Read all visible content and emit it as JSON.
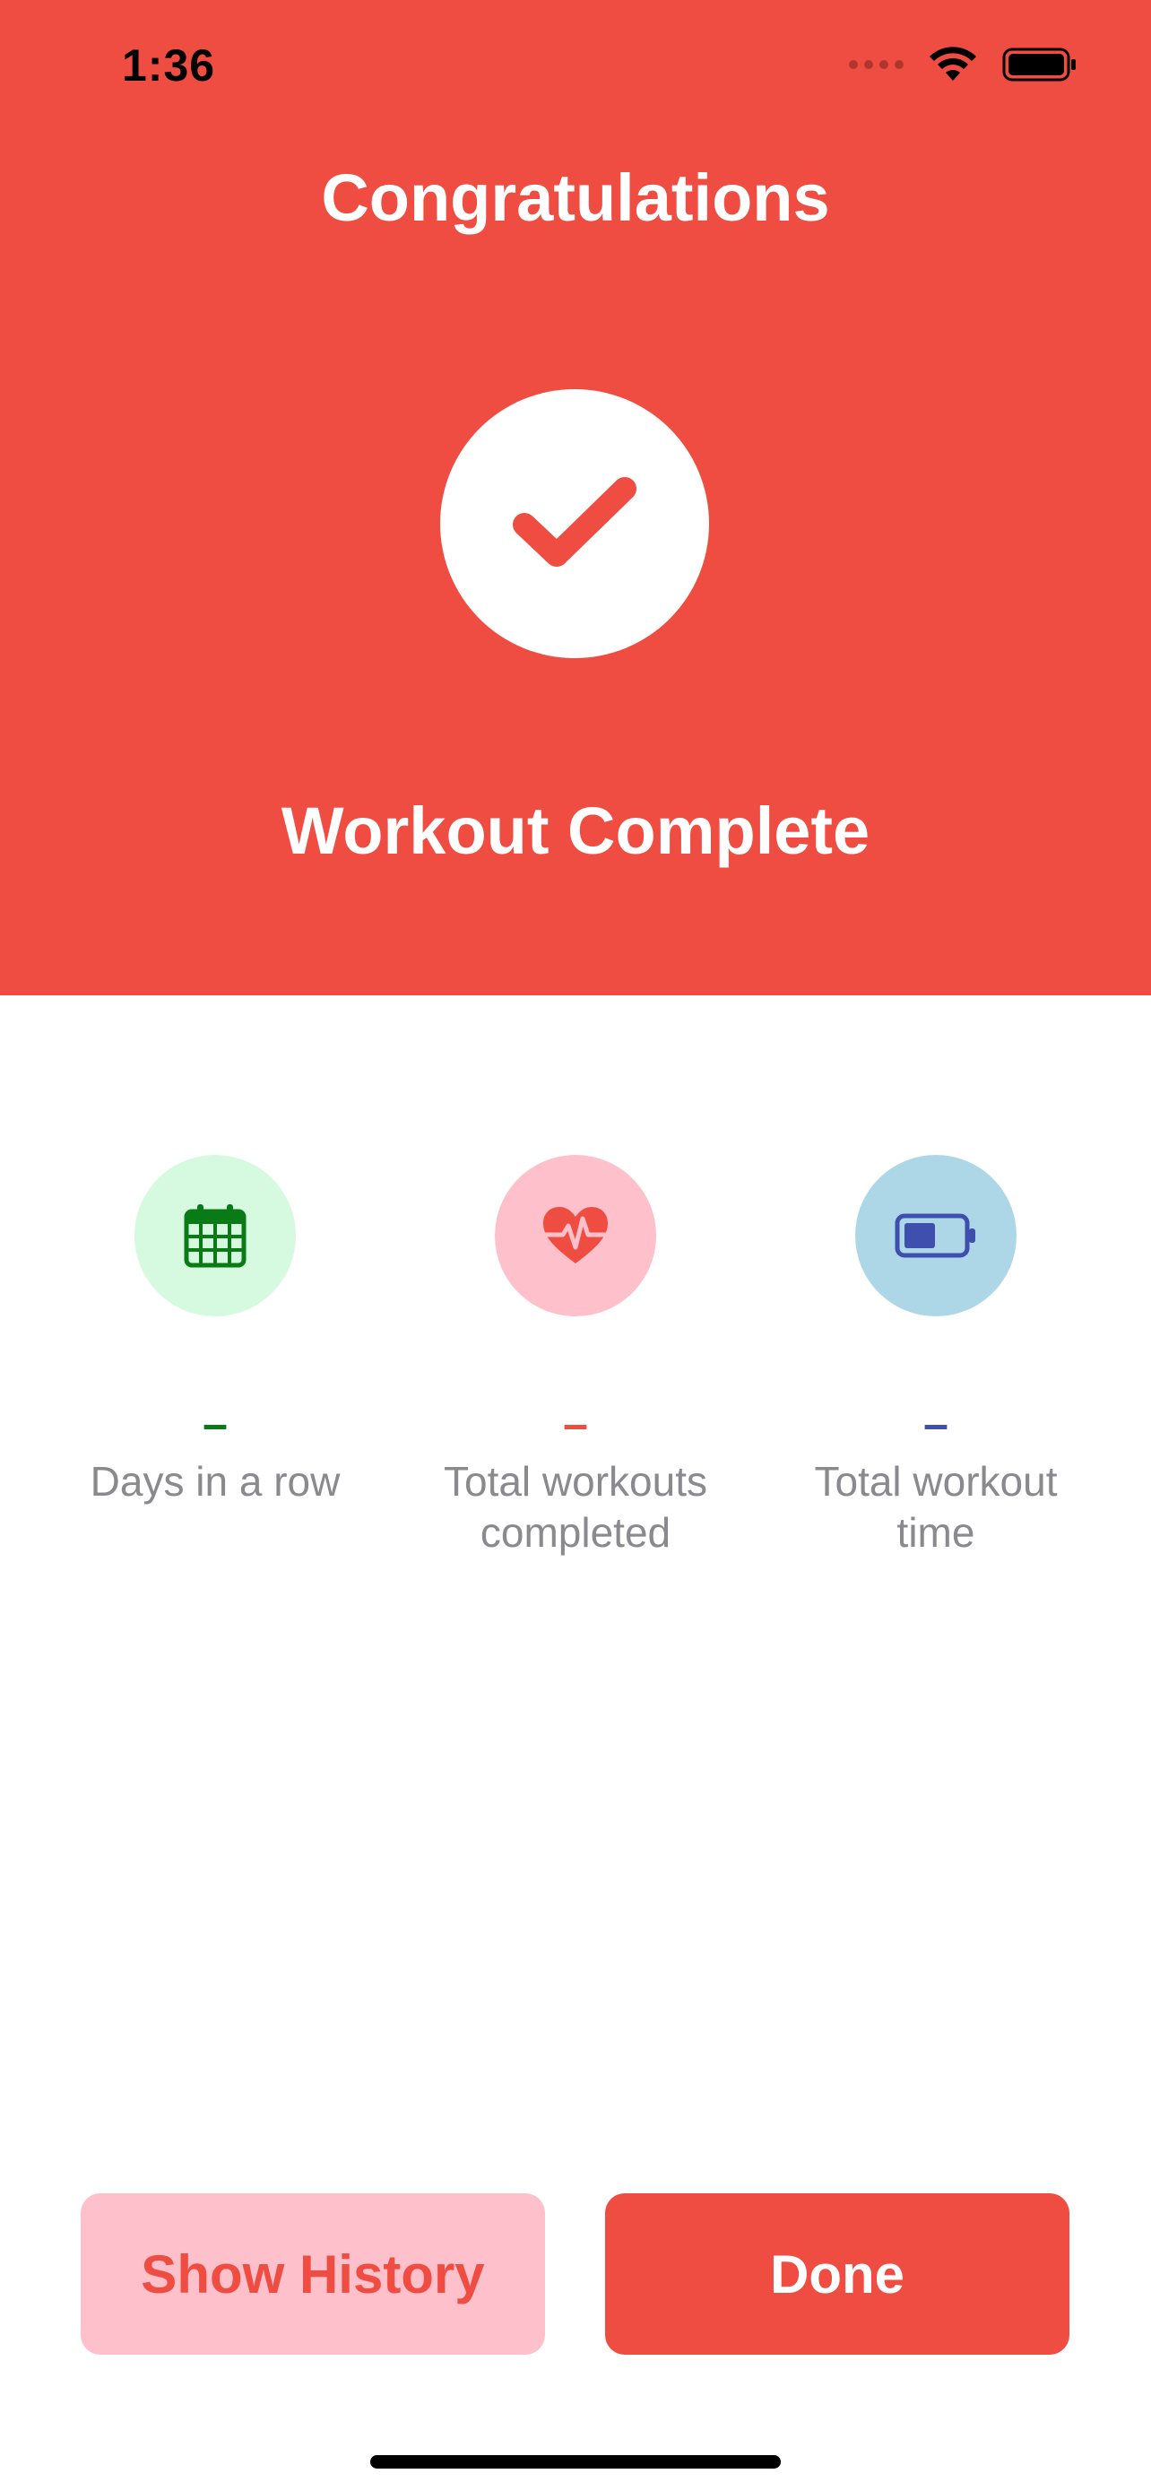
{
  "status_bar": {
    "time": "1:36",
    "icons": [
      "cellular-signal-icon",
      "wifi-icon",
      "battery-icon"
    ]
  },
  "header": {
    "title": "Congratulations",
    "icon": "checkmark-icon",
    "subtitle": "Workout Complete",
    "background_color": "#F04D42"
  },
  "stats": [
    {
      "icon": "calendar-icon",
      "icon_bg": "#D5FADF",
      "icon_color": "#0A7A16",
      "value": "–",
      "value_color": "#0A7A16",
      "label": "Days in a row"
    },
    {
      "icon": "heart-pulse-icon",
      "icon_bg": "#FEC0CB",
      "icon_color": "#F04D42",
      "value": "–",
      "value_color": "#F04D42",
      "label": "Total workouts completed"
    },
    {
      "icon": "battery-half-icon",
      "icon_bg": "#ADD7E6",
      "icon_color": "#3E4FAE",
      "value": "–",
      "value_color": "#3E4FAE",
      "label": "Total workout time"
    }
  ],
  "buttons": {
    "show_history": "Show History",
    "done": "Done"
  }
}
